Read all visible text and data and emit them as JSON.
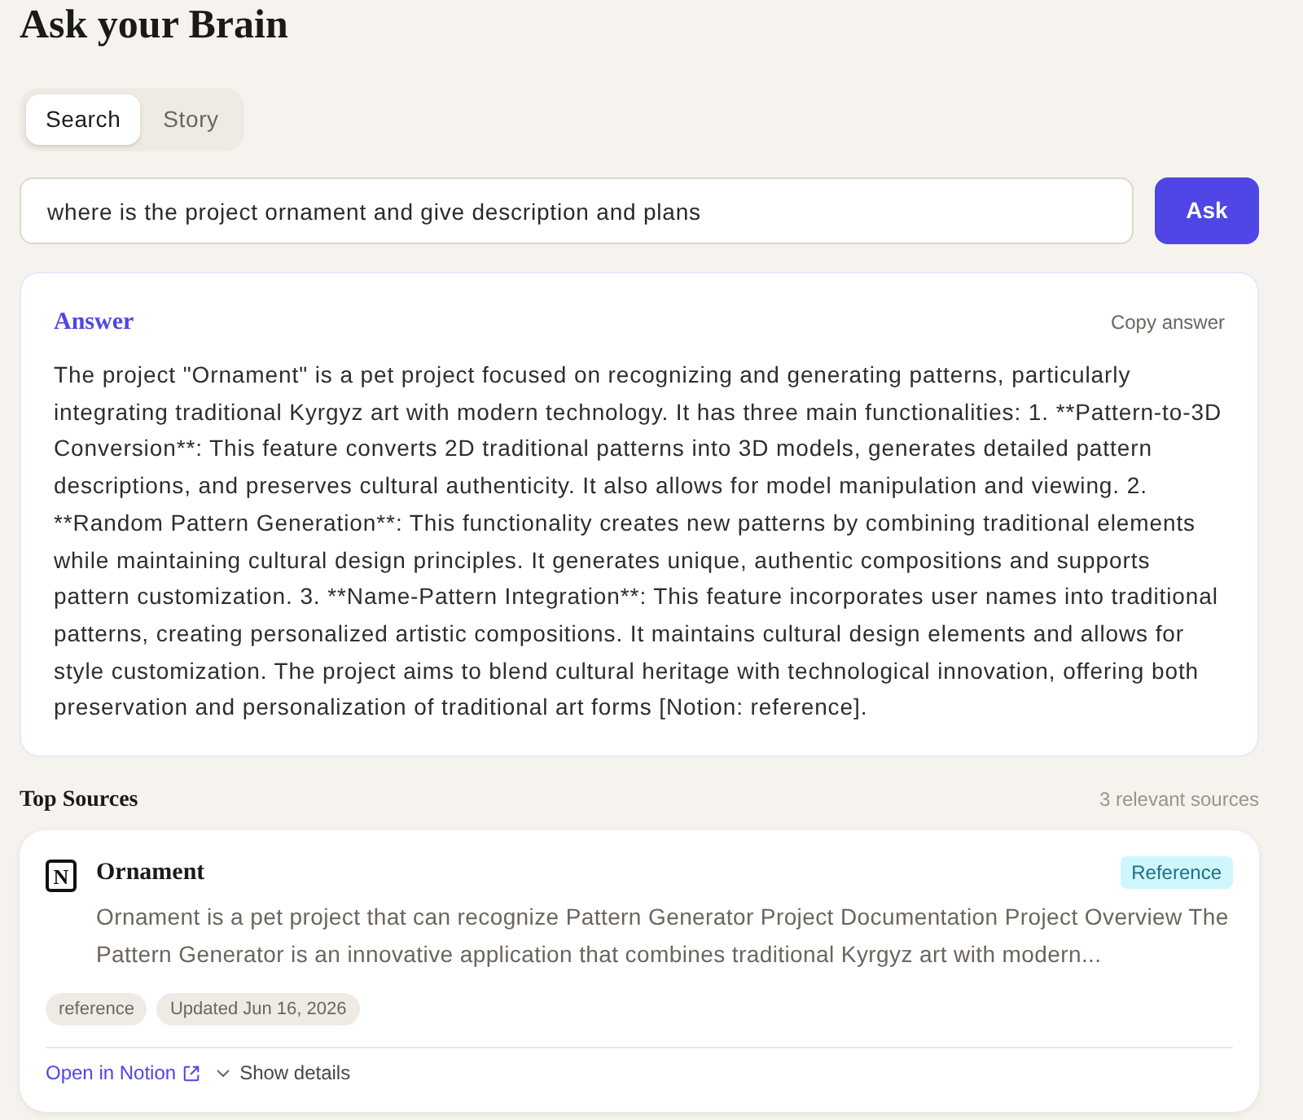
{
  "page": {
    "title": "Ask your Brain"
  },
  "tabs": [
    {
      "label": "Search",
      "selected": true
    },
    {
      "label": "Story",
      "selected": false
    }
  ],
  "query": {
    "value": "where is the project ornament and give description and plans",
    "button": "Ask"
  },
  "answer": {
    "heading": "Answer",
    "copy_action": "Copy answer",
    "text": "The project \"Ornament\" is a pet project focused on recognizing and generating patterns, particularly integrating traditional Kyrgyz art with modern technology. It has three main functionalities: 1. **Pattern-to-3D Conversion**: This feature converts 2D traditional patterns into 3D models, generates detailed pattern descriptions, and preserves cultural authenticity. It also allows for model manipulation and viewing. 2. **Random Pattern Generation**: This functionality creates new patterns by combining traditional elements while maintaining cultural design principles. It generates unique, authentic compositions and supports pattern customization. 3. **Name-Pattern Integration**: This feature incorporates user names into traditional patterns, creating personalized artistic compositions. It maintains cultural design elements and allows for style customization. The project aims to blend cultural heritage with technological innovation, offering both preservation and personalization of traditional art forms [Notion: reference]."
  },
  "sources": {
    "heading": "Top Sources",
    "count": "3 relevant sources",
    "items": [
      {
        "icon_glyph": "N",
        "title": "Ornament",
        "badge": "Reference",
        "description": "Ornament is a pet project that can recognize Pattern Generator Project Documentation Project Overview The Pattern Generator is an innovative application that combines traditional Kyrgyz art with modern...",
        "tags": [
          "reference",
          "Updated Jun 16, 2026"
        ],
        "open_link": "Open in Notion",
        "details_toggle": "Show details"
      }
    ]
  }
}
